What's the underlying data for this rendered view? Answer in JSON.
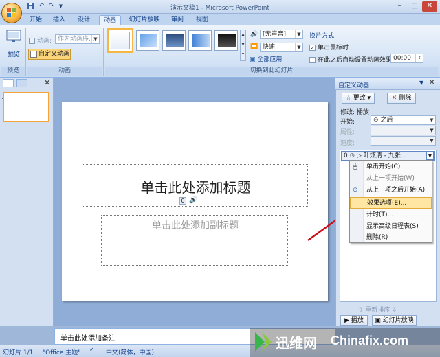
{
  "window": {
    "title": "演示文稿1 - Microsoft PowerPoint"
  },
  "quick_access": {
    "items": [
      "save-icon",
      "undo-icon",
      "redo-icon",
      "dropdown-icon"
    ]
  },
  "tabs": [
    "开始",
    "插入",
    "设计",
    "动画",
    "幻灯片放映",
    "审阅",
    "视图"
  ],
  "active_tab": "动画",
  "ribbon": {
    "preview_label": "预览",
    "preview_group": "预览",
    "animate_label": "动画:",
    "animate_value": "作为动画序...",
    "custom_anim_label": "自定义动画",
    "anim_group": "动画",
    "transition_group": "切换到此幻灯片",
    "sound_value": "[无声音]",
    "speed_value": "快速",
    "apply_all_label": "全部应用",
    "advance_header": "换片方式",
    "on_click_label": "单击鼠标时",
    "after_label": "在此之后自动设置动画效果:",
    "after_value": "00:00"
  },
  "slide": {
    "title_placeholder": "单击此处添加标题",
    "subtitle_placeholder": "单击此处添加副标题",
    "anim_tag": "0"
  },
  "notes_placeholder": "单击此处添加备注",
  "task_pane": {
    "title": "自定义动画",
    "change_label": "更改",
    "delete_label": "删除",
    "modify_label": "修改: 播放",
    "start_label": "开始:",
    "start_value": "之后",
    "property_label": "属性:",
    "speed_label": "速度:",
    "list_item_num": "0",
    "list_item_text": "叶炫清 - 九张...",
    "reorder_label": "重新排序",
    "play_label": "播放",
    "slideshow_label": "幻灯片放映"
  },
  "context_menu": {
    "items": [
      {
        "label": "单击开始(C)",
        "icon": "mouse-icon"
      },
      {
        "label": "从上一项开始(W)",
        "icon": ""
      },
      {
        "label": "从上一项之后开始(A)",
        "icon": "clock-icon"
      },
      {
        "label": "效果选项(E)...",
        "icon": ""
      },
      {
        "label": "计时(T)...",
        "icon": ""
      },
      {
        "label": "显示高级日程表(S)",
        "icon": ""
      },
      {
        "label": "删除(R)",
        "icon": ""
      }
    ],
    "highlighted_index": 3
  },
  "status_bar": {
    "slide_info": "幻灯片 1/1",
    "theme": "\"Office 主题\"",
    "language": "中文(简体，中国)"
  },
  "watermark": {
    "site_cn": "迅维网",
    "site_en": "Chinafix.com"
  },
  "colors": {
    "accent": "#15428b",
    "highlight": "#ffe6a2",
    "arrow": "#c8101a"
  }
}
